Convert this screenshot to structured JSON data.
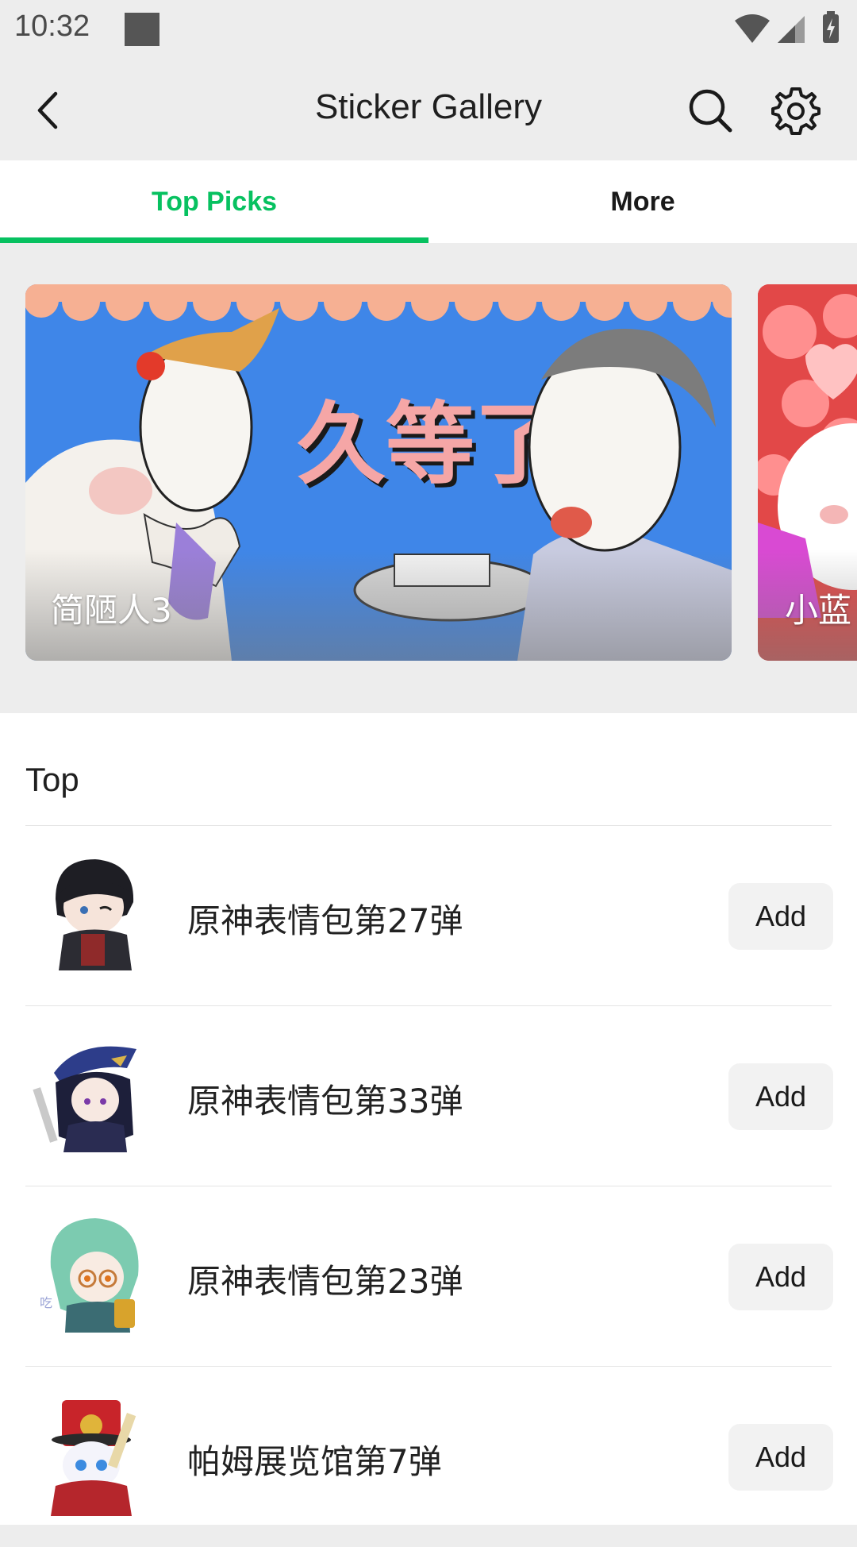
{
  "status_bar": {
    "time": "10:32",
    "icons": [
      "wifi-icon",
      "cell-signal-icon",
      "battery-charging-icon"
    ]
  },
  "header": {
    "title": "Sticker Gallery",
    "back_icon": "chevron-left-icon",
    "search_icon": "search-icon",
    "settings_icon": "gear-icon"
  },
  "tabs": [
    {
      "label": "Top Picks",
      "active": true
    },
    {
      "label": "More",
      "active": false
    }
  ],
  "banners": [
    {
      "label": "简陋人3",
      "banner_text": "久等了"
    },
    {
      "label": "小蓝"
    }
  ],
  "list": {
    "section_title": "Top",
    "items": [
      {
        "title": "原神表情包第27弹",
        "action": "Add"
      },
      {
        "title": "原神表情包第33弹",
        "action": "Add"
      },
      {
        "title": "原神表情包第23弹",
        "action": "Add"
      },
      {
        "title": "帕姆展览馆第7弹",
        "action": "Add"
      }
    ]
  },
  "colors": {
    "accent": "#07c160",
    "background": "#ededed",
    "banner_blue": "#3f86e8",
    "banner_scallop": "#f6b093"
  }
}
